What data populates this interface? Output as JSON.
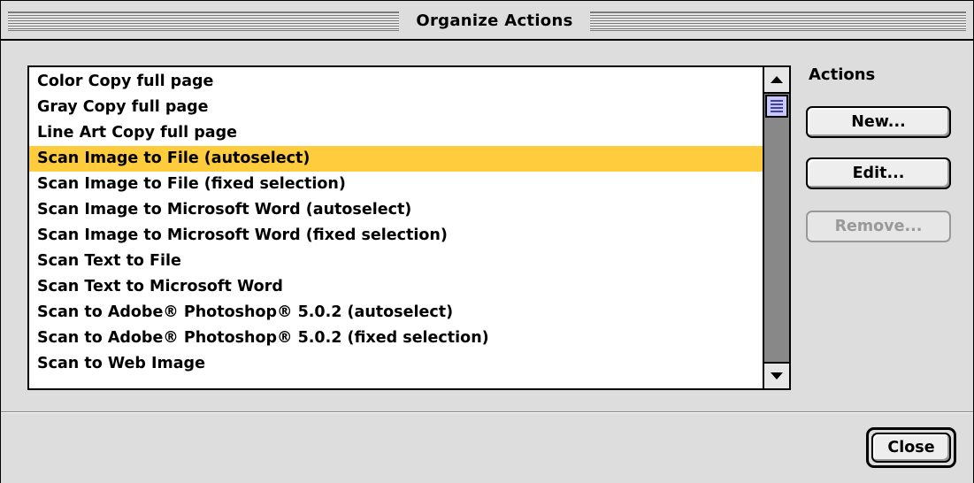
{
  "window": {
    "title": "Organize Actions"
  },
  "list": {
    "items": [
      "Color Copy full page",
      "Gray Copy full page",
      "Line Art Copy full page",
      "Scan Image to File (autoselect)",
      "Scan Image to File (fixed selection)",
      "Scan Image to Microsoft Word (autoselect)",
      "Scan Image to Microsoft Word (fixed selection)",
      "Scan Text to File",
      "Scan Text to Microsoft Word",
      "Scan to Adobe® Photoshop® 5.0.2 (autoselect)",
      "Scan to Adobe® Photoshop® 5.0.2 (fixed selection)",
      "Scan to Web Image"
    ],
    "selected": "Scan Image to File (autoselect)"
  },
  "actions": {
    "label": "Actions",
    "new_label": "New...",
    "edit_label": "Edit...",
    "remove_label": "Remove..."
  },
  "footer": {
    "close_label": "Close"
  },
  "colors": {
    "selection": "#ffcc3e",
    "window_bg": "#dddddd",
    "scroll_thumb": "#c8c8ff"
  },
  "icons": {
    "scroll_up": "up-arrow-icon",
    "scroll_down": "down-arrow-icon"
  }
}
